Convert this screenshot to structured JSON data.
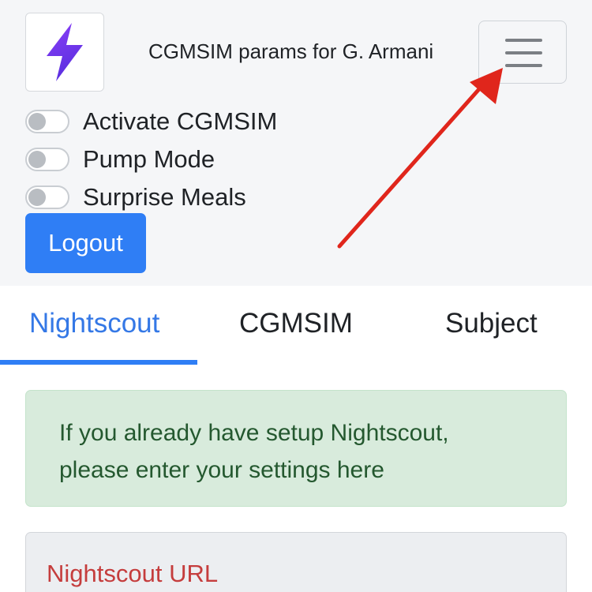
{
  "header": {
    "brand_text": "CGMSIM params for G. Armani",
    "logo_icon": "lightning-bolt-icon",
    "menu_icon": "hamburger-menu-icon",
    "toggles": [
      {
        "label": "Activate CGMSIM",
        "checked": false
      },
      {
        "label": "Pump Mode",
        "checked": false
      },
      {
        "label": "Surprise Meals",
        "checked": false
      }
    ],
    "logout_label": "Logout"
  },
  "tabs": {
    "items": [
      {
        "label": "Nightscout",
        "active": true
      },
      {
        "label": "CGMSIM",
        "active": false
      },
      {
        "label": "Subject",
        "active": false
      }
    ]
  },
  "alert": {
    "line1": "If you already have setup Nightscout,",
    "line2": "please enter your settings here"
  },
  "form": {
    "nightscout_url_label": "Nightscout URL"
  },
  "annotation": {
    "arrow_color": "#e0261c"
  },
  "colors": {
    "primary": "#2f7ef5",
    "alert_bg": "#d8ebdc",
    "alert_text": "#24582f",
    "label_red": "#c53d3d"
  }
}
